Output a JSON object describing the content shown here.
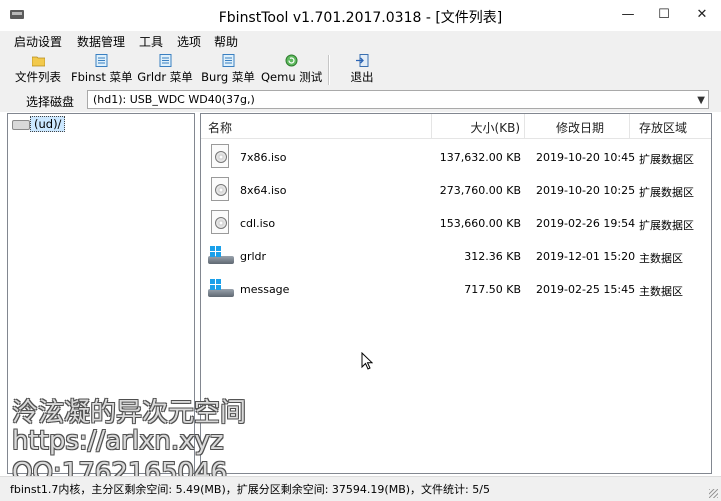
{
  "window": {
    "title": "FbinstTool v1.701.2017.0318 - [文件列表]",
    "minimize": "—",
    "maximize": "☐",
    "close": "✕"
  },
  "menu": [
    "启动设置",
    "数据管理",
    "工具",
    "选项",
    "帮助"
  ],
  "toolbar": {
    "file_list": "文件列表",
    "fbinst_menu": "Fbinst 菜单",
    "grldr_menu": "Grldr 菜单",
    "burg_menu": "Burg 菜单",
    "qemu_test": "Qemu 测试",
    "exit": "退出"
  },
  "disk": {
    "label": "选择磁盘",
    "value": "(hd1): USB_WDC WD40(37g,)"
  },
  "tree": {
    "root": "(ud)/"
  },
  "list": {
    "columns": {
      "name": "名称",
      "size": "大小(KB)",
      "date": "修改日期",
      "area": "存放区域"
    },
    "rows": [
      {
        "name": "7x86.iso",
        "size": "137,632.00 KB",
        "date": "2019-10-20 10:45",
        "area": "扩展数据区",
        "icon": "disc-file-icon"
      },
      {
        "name": "8x64.iso",
        "size": "273,760.00 KB",
        "date": "2019-10-20 10:25",
        "area": "扩展数据区",
        "icon": "disc-file-icon"
      },
      {
        "name": "cdl.iso",
        "size": "153,660.00 KB",
        "date": "2019-02-26 19:54",
        "area": "扩展数据区",
        "icon": "disc-file-icon"
      },
      {
        "name": "grldr",
        "size": "312.36 KB",
        "date": "2019-12-01 15:20",
        "area": "主数据区",
        "icon": "windows-drive-icon"
      },
      {
        "name": "message",
        "size": "717.50 KB",
        "date": "2019-02-25 15:45",
        "area": "主数据区",
        "icon": "windows-drive-icon"
      }
    ]
  },
  "status": {
    "text": "fbinst1.7内核，主分区剩余空间: 5.49(MB)，扩展分区剩余空间: 37594.19(MB)，文件统计: 5/5"
  },
  "watermark": {
    "line1": "泠泫凝的异次元空间",
    "line2": "https://arlxn.xyz",
    "line3": "QQ:1762165046"
  },
  "colors": {
    "chrome": "#f0f0f0",
    "selection": "#cce8ff",
    "windows_blue": "#1aa0ea"
  }
}
